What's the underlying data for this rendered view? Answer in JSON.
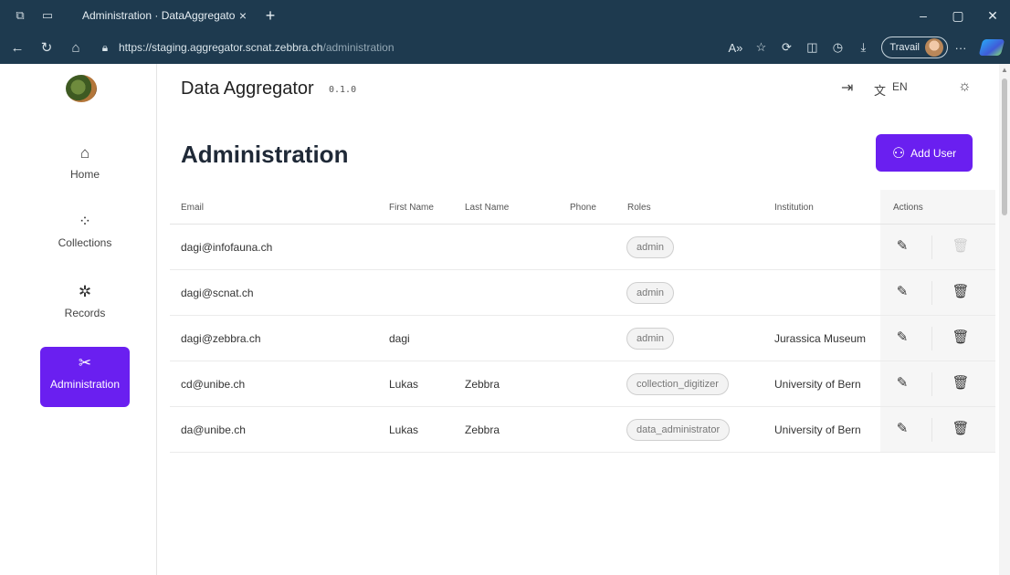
{
  "browser": {
    "tab_title": "Administration · DataAggregator",
    "tab_close": "×",
    "new_tab": "+",
    "url_host": "https://staging.aggregator.scnat.zebbra.ch",
    "url_path": "/administration",
    "profile_label": "Travail",
    "more": "···",
    "win_min": "–",
    "win_max": "▢",
    "win_close": "✕"
  },
  "app": {
    "title": "Data Aggregator",
    "version": "0.1.0",
    "language": "EN"
  },
  "sidebar": {
    "items": [
      {
        "label": "Home",
        "icon": "home-icon"
      },
      {
        "label": "Collections",
        "icon": "collections-icon"
      },
      {
        "label": "Records",
        "icon": "records-icon"
      },
      {
        "label": "Administration",
        "icon": "tools-icon",
        "active": true
      }
    ],
    "accent": "#6a1ff0"
  },
  "page": {
    "title": "Administration",
    "add_user_label": "Add User"
  },
  "table": {
    "headers": [
      "Email",
      "First Name",
      "Last Name",
      "Phone",
      "Roles",
      "Institution",
      "Actions"
    ],
    "rows": [
      {
        "email": "dagi@infofauna.ch",
        "first": "",
        "last": "",
        "phone": "",
        "role": "admin",
        "institution": "",
        "delete_enabled": false
      },
      {
        "email": "dagi@scnat.ch",
        "first": "",
        "last": "",
        "phone": "",
        "role": "admin",
        "institution": "",
        "delete_enabled": true
      },
      {
        "email": "dagi@zebbra.ch",
        "first": "dagi",
        "last": "",
        "phone": "",
        "role": "admin",
        "institution": "Jurassica Museum",
        "delete_enabled": true
      },
      {
        "email": "cd@unibe.ch",
        "first": "Lukas",
        "last": "Zebbra",
        "phone": "",
        "role": "collection_digitizer",
        "institution": "University of Bern",
        "delete_enabled": true
      },
      {
        "email": "da@unibe.ch",
        "first": "Lukas",
        "last": "Zebbra",
        "phone": "",
        "role": "data_administrator",
        "institution": "University of Bern",
        "delete_enabled": true
      }
    ]
  }
}
